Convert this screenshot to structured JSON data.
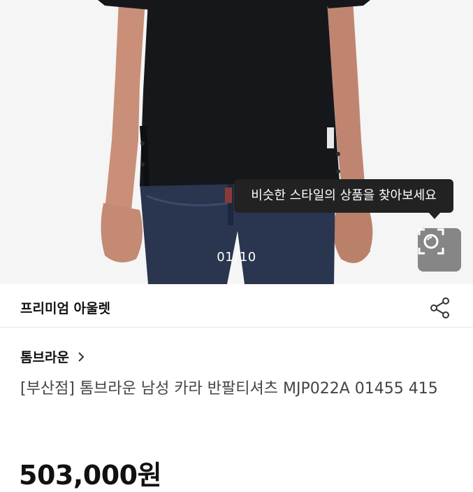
{
  "gallery": {
    "current_index": "01",
    "separator": "/",
    "total": "10"
  },
  "tooltip": {
    "text": "비슷한 스타일의 상품을 찾아보세요"
  },
  "lens_button": {
    "icon": "lens-search-icon"
  },
  "seller": {
    "name": "프리미엄 아울렛",
    "share_icon": "share-icon"
  },
  "product": {
    "brand": "톰브라운",
    "brand_chevron_icon": "chevron-right-icon",
    "title": "[부산점] 톰브라운 남성 카라 반팔티셔츠 MJP022A 01455 415",
    "price": "503,000원"
  },
  "colors": {
    "tooltip_bg": "#222222",
    "lens_bg": "#6e6e6e",
    "shirt": "#16171b",
    "jeans": "#2a3550",
    "skin": "#c98f78"
  }
}
